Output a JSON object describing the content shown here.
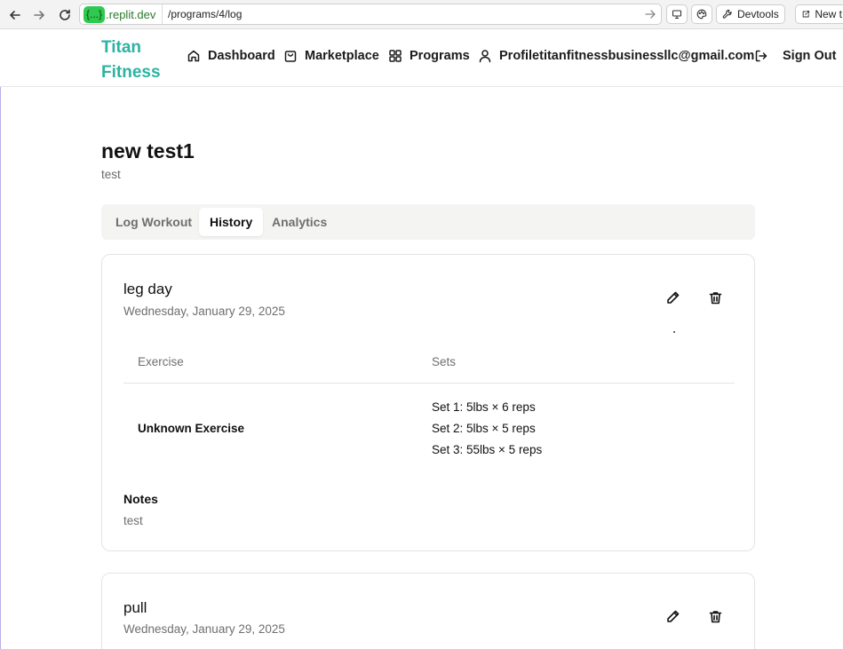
{
  "browser": {
    "host_pill": "{...}",
    "host": ".replit.dev",
    "path": "/programs/4/log",
    "devtools_label": "Devtools",
    "new_tab_label": "New t"
  },
  "header": {
    "brand_line1": "Titan",
    "brand_line2": "Fitness",
    "brand_color": "#2bb3a3",
    "nav": {
      "dashboard": "Dashboard",
      "marketplace": "Marketplace",
      "programs": "Programs",
      "profile": "Profiletitanfitnessbusinessllc@gmail.com",
      "sign_out": "Sign Out"
    }
  },
  "page": {
    "title": "new test1",
    "subtitle": "test"
  },
  "tabs": [
    {
      "label": "Log Workout",
      "active": false
    },
    {
      "label": "History",
      "active": true
    },
    {
      "label": "Analytics",
      "active": false
    }
  ],
  "workouts": [
    {
      "title": "leg day",
      "date": "Wednesday, January 29, 2025",
      "col_exercise": "Exercise",
      "col_sets": "Sets",
      "exercise_name": "Unknown Exercise",
      "sets": [
        "Set 1: 5lbs × 6 reps",
        "Set 2: 5lbs × 5 reps",
        "Set 3: 55lbs × 5 reps"
      ],
      "notes_label": "Notes",
      "notes": "test"
    },
    {
      "title": "pull",
      "date": "Wednesday, January 29, 2025"
    }
  ]
}
